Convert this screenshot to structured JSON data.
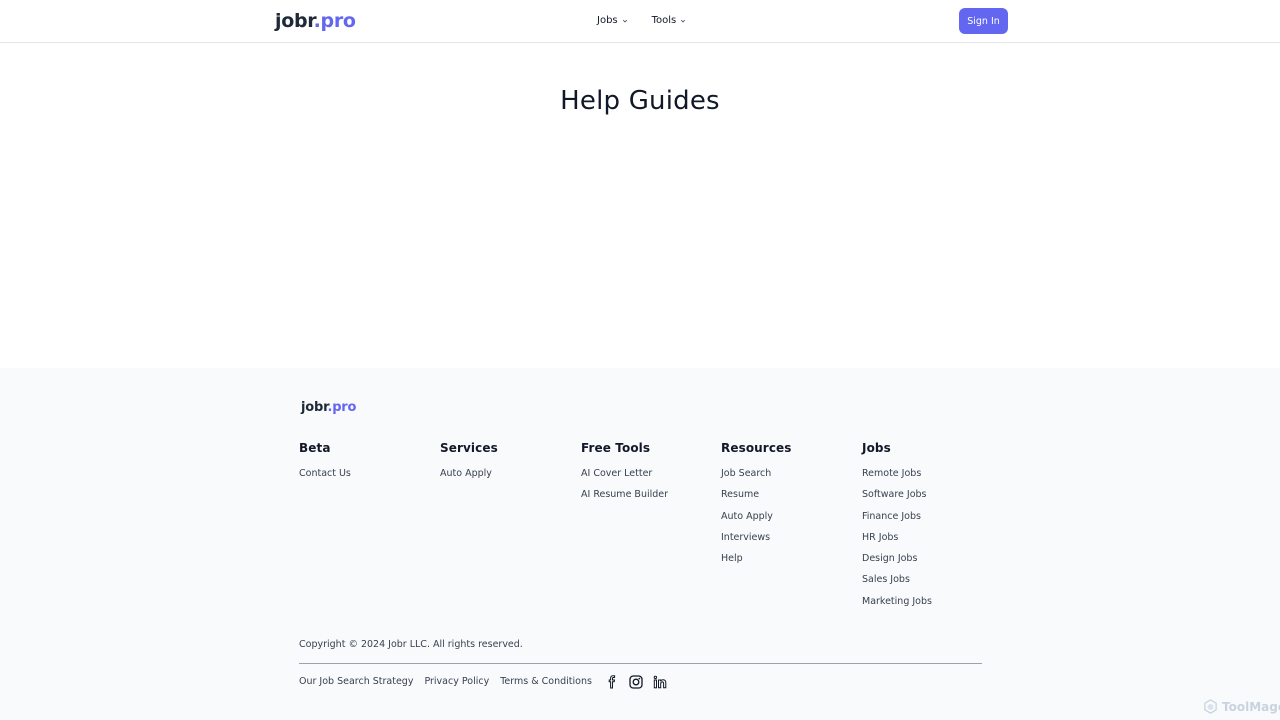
{
  "header": {
    "logo_main": "jobr",
    "logo_accent": ".pro",
    "nav": [
      {
        "label": "Jobs"
      },
      {
        "label": "Tools"
      }
    ],
    "signin_label": "Sign In"
  },
  "main": {
    "title": "Help Guides"
  },
  "footer": {
    "logo_main": "jobr",
    "logo_accent": ".pro",
    "columns": [
      {
        "heading": "Beta",
        "links": [
          "Contact Us"
        ]
      },
      {
        "heading": "Services",
        "links": [
          "Auto Apply"
        ]
      },
      {
        "heading": "Free Tools",
        "links": [
          "AI Cover Letter",
          "AI Resume Builder"
        ]
      },
      {
        "heading": "Resources",
        "links": [
          "Job Search",
          "Resume",
          "Auto Apply",
          "Interviews",
          "Help"
        ]
      },
      {
        "heading": "Jobs",
        "links": [
          "Remote Jobs",
          "Software Jobs",
          "Finance Jobs",
          "HR Jobs",
          "Design Jobs",
          "Sales Jobs",
          "Marketing Jobs"
        ]
      }
    ],
    "copyright": "Copyright © 2024 Jobr LLC. All rights reserved.",
    "bottom_links": [
      "Our Job Search Strategy",
      "Privacy Policy",
      "Terms & Conditions"
    ],
    "social_icons": [
      "facebook-icon",
      "instagram-icon",
      "linkedin-icon"
    ]
  },
  "watermark": "ToolMage",
  "colors": {
    "accent": "#6366f1",
    "footer_bg": "#f9fafb"
  }
}
